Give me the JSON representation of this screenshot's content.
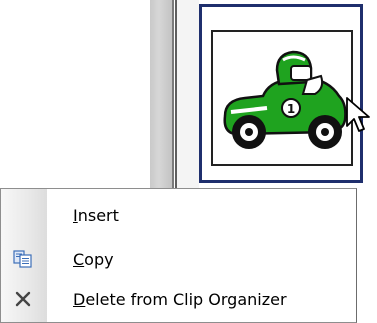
{
  "clip": {
    "number_badge": "1"
  },
  "context_menu": {
    "items": [
      {
        "accel": "I",
        "rest": "nsert",
        "icon": ""
      },
      {
        "accel": "C",
        "rest": "opy",
        "icon": "copy-icon"
      },
      {
        "accel": "D",
        "rest": "elete from Clip Organizer",
        "icon": "delete-icon"
      }
    ]
  },
  "colors": {
    "selection_border": "#1f2f6d",
    "car_green": "#1fa31f",
    "menu_strip": "#e9e9e9"
  }
}
